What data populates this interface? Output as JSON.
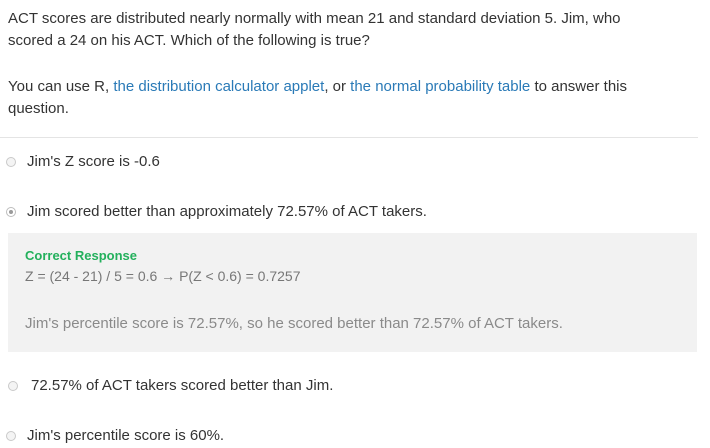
{
  "question": {
    "line1": "ACT scores are distributed nearly normally with mean 21 and standard deviation 5. Jim, who",
    "line2": "scored a 24 on his ACT. Which of the following is true?"
  },
  "tools": {
    "prefix": "You can use R, ",
    "link1": "the distribution calculator applet",
    "middle": ", or ",
    "link2": "the normal probability table",
    "suffix_line1": " to answer this",
    "suffix_line2": "question."
  },
  "options": [
    {
      "label": "Jim's Z score is -0.6",
      "selected": false
    },
    {
      "label": "Jim scored better than approximately 72.57% of ACT takers.",
      "selected": true
    },
    {
      "label": "72.57% of ACT takers scored better than Jim.",
      "selected": false
    },
    {
      "label": "Jim's percentile score is 60%.",
      "selected": false
    }
  ],
  "feedback": {
    "title": "Correct Response",
    "formula": "Z = (24 - 21) / 5 = 0.6 → P(Z < 0.6) = 0.7257",
    "explanation": "Jim's percentile score is 72.57%, so he scored better than 72.57% of ACT takers."
  },
  "colors": {
    "link": "#2a7ab7",
    "correct": "#23b05c",
    "feedback_bg": "#f2f2f2"
  }
}
